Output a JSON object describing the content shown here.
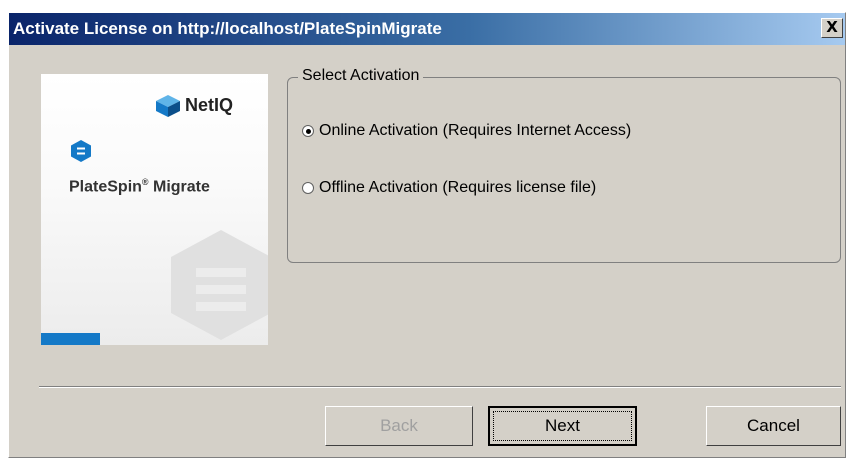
{
  "window": {
    "title": "Activate License on http://localhost/PlateSpinMigrate",
    "close_label": "X"
  },
  "branding": {
    "company": "NetIQ",
    "product": "PlateSpin",
    "product_suffix": " Migrate",
    "registered_mark": "®",
    "accent_color": "#1479c7"
  },
  "activation": {
    "group_label": "Select Activation",
    "options": [
      {
        "label": "Online Activation (Requires Internet Access)",
        "selected": true
      },
      {
        "label": "Offline Activation (Requires license file)",
        "selected": false
      }
    ]
  },
  "buttons": {
    "back": "Back",
    "next": "Next",
    "cancel": "Cancel"
  }
}
